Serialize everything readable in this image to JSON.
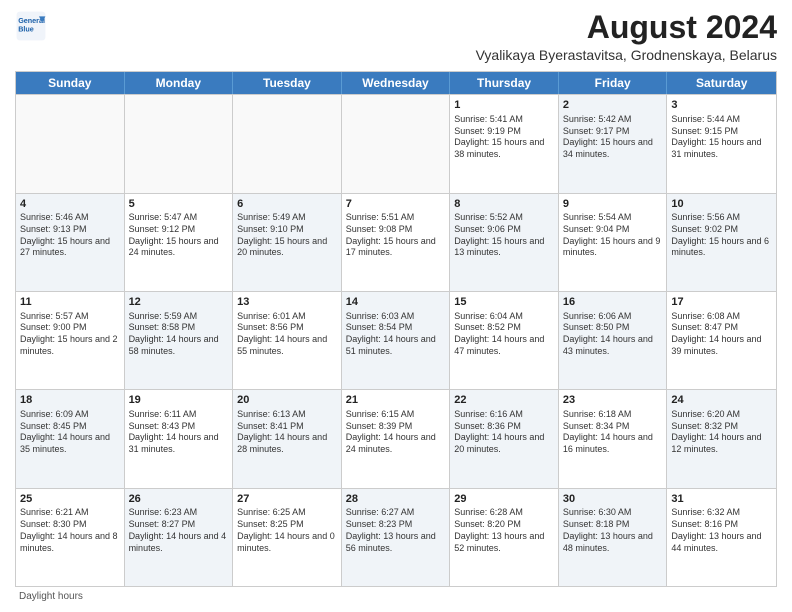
{
  "header": {
    "title": "August 2024",
    "subtitle": "Vyalikaya Byerastavitsa, Grodnenskaya, Belarus",
    "logo_line1": "General",
    "logo_line2": "Blue"
  },
  "days_of_week": [
    "Sunday",
    "Monday",
    "Tuesday",
    "Wednesday",
    "Thursday",
    "Friday",
    "Saturday"
  ],
  "footer_label": "Daylight hours",
  "weeks": [
    [
      {
        "day": "",
        "sunrise": "",
        "sunset": "",
        "daylight": "",
        "shaded": false
      },
      {
        "day": "",
        "sunrise": "",
        "sunset": "",
        "daylight": "",
        "shaded": false
      },
      {
        "day": "",
        "sunrise": "",
        "sunset": "",
        "daylight": "",
        "shaded": false
      },
      {
        "day": "",
        "sunrise": "",
        "sunset": "",
        "daylight": "",
        "shaded": false
      },
      {
        "day": "1",
        "sunrise": "Sunrise: 5:41 AM",
        "sunset": "Sunset: 9:19 PM",
        "daylight": "Daylight: 15 hours and 38 minutes.",
        "shaded": false
      },
      {
        "day": "2",
        "sunrise": "Sunrise: 5:42 AM",
        "sunset": "Sunset: 9:17 PM",
        "daylight": "Daylight: 15 hours and 34 minutes.",
        "shaded": true
      },
      {
        "day": "3",
        "sunrise": "Sunrise: 5:44 AM",
        "sunset": "Sunset: 9:15 PM",
        "daylight": "Daylight: 15 hours and 31 minutes.",
        "shaded": false
      }
    ],
    [
      {
        "day": "4",
        "sunrise": "Sunrise: 5:46 AM",
        "sunset": "Sunset: 9:13 PM",
        "daylight": "Daylight: 15 hours and 27 minutes.",
        "shaded": true
      },
      {
        "day": "5",
        "sunrise": "Sunrise: 5:47 AM",
        "sunset": "Sunset: 9:12 PM",
        "daylight": "Daylight: 15 hours and 24 minutes.",
        "shaded": false
      },
      {
        "day": "6",
        "sunrise": "Sunrise: 5:49 AM",
        "sunset": "Sunset: 9:10 PM",
        "daylight": "Daylight: 15 hours and 20 minutes.",
        "shaded": true
      },
      {
        "day": "7",
        "sunrise": "Sunrise: 5:51 AM",
        "sunset": "Sunset: 9:08 PM",
        "daylight": "Daylight: 15 hours and 17 minutes.",
        "shaded": false
      },
      {
        "day": "8",
        "sunrise": "Sunrise: 5:52 AM",
        "sunset": "Sunset: 9:06 PM",
        "daylight": "Daylight: 15 hours and 13 minutes.",
        "shaded": true
      },
      {
        "day": "9",
        "sunrise": "Sunrise: 5:54 AM",
        "sunset": "Sunset: 9:04 PM",
        "daylight": "Daylight: 15 hours and 9 minutes.",
        "shaded": false
      },
      {
        "day": "10",
        "sunrise": "Sunrise: 5:56 AM",
        "sunset": "Sunset: 9:02 PM",
        "daylight": "Daylight: 15 hours and 6 minutes.",
        "shaded": true
      }
    ],
    [
      {
        "day": "11",
        "sunrise": "Sunrise: 5:57 AM",
        "sunset": "Sunset: 9:00 PM",
        "daylight": "Daylight: 15 hours and 2 minutes.",
        "shaded": false
      },
      {
        "day": "12",
        "sunrise": "Sunrise: 5:59 AM",
        "sunset": "Sunset: 8:58 PM",
        "daylight": "Daylight: 14 hours and 58 minutes.",
        "shaded": true
      },
      {
        "day": "13",
        "sunrise": "Sunrise: 6:01 AM",
        "sunset": "Sunset: 8:56 PM",
        "daylight": "Daylight: 14 hours and 55 minutes.",
        "shaded": false
      },
      {
        "day": "14",
        "sunrise": "Sunrise: 6:03 AM",
        "sunset": "Sunset: 8:54 PM",
        "daylight": "Daylight: 14 hours and 51 minutes.",
        "shaded": true
      },
      {
        "day": "15",
        "sunrise": "Sunrise: 6:04 AM",
        "sunset": "Sunset: 8:52 PM",
        "daylight": "Daylight: 14 hours and 47 minutes.",
        "shaded": false
      },
      {
        "day": "16",
        "sunrise": "Sunrise: 6:06 AM",
        "sunset": "Sunset: 8:50 PM",
        "daylight": "Daylight: 14 hours and 43 minutes.",
        "shaded": true
      },
      {
        "day": "17",
        "sunrise": "Sunrise: 6:08 AM",
        "sunset": "Sunset: 8:47 PM",
        "daylight": "Daylight: 14 hours and 39 minutes.",
        "shaded": false
      }
    ],
    [
      {
        "day": "18",
        "sunrise": "Sunrise: 6:09 AM",
        "sunset": "Sunset: 8:45 PM",
        "daylight": "Daylight: 14 hours and 35 minutes.",
        "shaded": true
      },
      {
        "day": "19",
        "sunrise": "Sunrise: 6:11 AM",
        "sunset": "Sunset: 8:43 PM",
        "daylight": "Daylight: 14 hours and 31 minutes.",
        "shaded": false
      },
      {
        "day": "20",
        "sunrise": "Sunrise: 6:13 AM",
        "sunset": "Sunset: 8:41 PM",
        "daylight": "Daylight: 14 hours and 28 minutes.",
        "shaded": true
      },
      {
        "day": "21",
        "sunrise": "Sunrise: 6:15 AM",
        "sunset": "Sunset: 8:39 PM",
        "daylight": "Daylight: 14 hours and 24 minutes.",
        "shaded": false
      },
      {
        "day": "22",
        "sunrise": "Sunrise: 6:16 AM",
        "sunset": "Sunset: 8:36 PM",
        "daylight": "Daylight: 14 hours and 20 minutes.",
        "shaded": true
      },
      {
        "day": "23",
        "sunrise": "Sunrise: 6:18 AM",
        "sunset": "Sunset: 8:34 PM",
        "daylight": "Daylight: 14 hours and 16 minutes.",
        "shaded": false
      },
      {
        "day": "24",
        "sunrise": "Sunrise: 6:20 AM",
        "sunset": "Sunset: 8:32 PM",
        "daylight": "Daylight: 14 hours and 12 minutes.",
        "shaded": true
      }
    ],
    [
      {
        "day": "25",
        "sunrise": "Sunrise: 6:21 AM",
        "sunset": "Sunset: 8:30 PM",
        "daylight": "Daylight: 14 hours and 8 minutes.",
        "shaded": false
      },
      {
        "day": "26",
        "sunrise": "Sunrise: 6:23 AM",
        "sunset": "Sunset: 8:27 PM",
        "daylight": "Daylight: 14 hours and 4 minutes.",
        "shaded": true
      },
      {
        "day": "27",
        "sunrise": "Sunrise: 6:25 AM",
        "sunset": "Sunset: 8:25 PM",
        "daylight": "Daylight: 14 hours and 0 minutes.",
        "shaded": false
      },
      {
        "day": "28",
        "sunrise": "Sunrise: 6:27 AM",
        "sunset": "Sunset: 8:23 PM",
        "daylight": "Daylight: 13 hours and 56 minutes.",
        "shaded": true
      },
      {
        "day": "29",
        "sunrise": "Sunrise: 6:28 AM",
        "sunset": "Sunset: 8:20 PM",
        "daylight": "Daylight: 13 hours and 52 minutes.",
        "shaded": false
      },
      {
        "day": "30",
        "sunrise": "Sunrise: 6:30 AM",
        "sunset": "Sunset: 8:18 PM",
        "daylight": "Daylight: 13 hours and 48 minutes.",
        "shaded": true
      },
      {
        "day": "31",
        "sunrise": "Sunrise: 6:32 AM",
        "sunset": "Sunset: 8:16 PM",
        "daylight": "Daylight: 13 hours and 44 minutes.",
        "shaded": false
      }
    ]
  ]
}
